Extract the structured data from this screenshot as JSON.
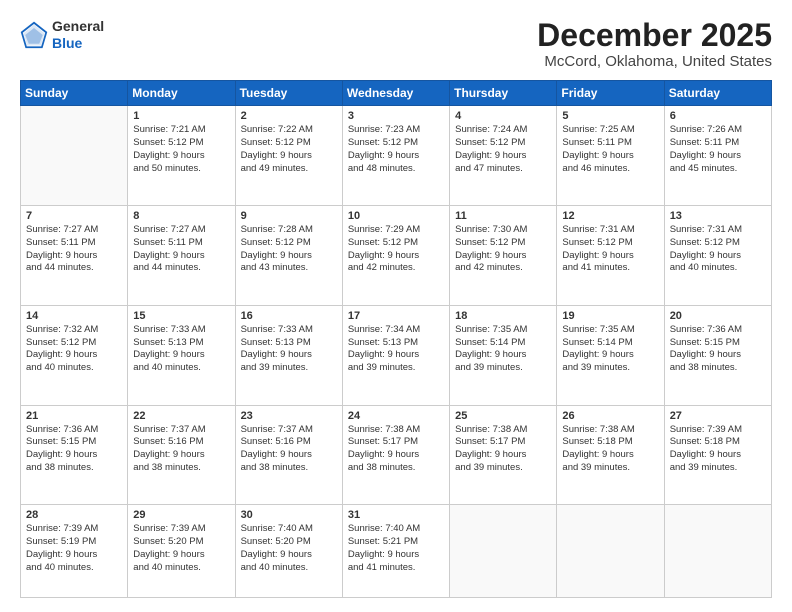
{
  "header": {
    "logo_general": "General",
    "logo_blue": "Blue",
    "month_title": "December 2025",
    "location": "McCord, Oklahoma, United States"
  },
  "weekdays": [
    "Sunday",
    "Monday",
    "Tuesday",
    "Wednesday",
    "Thursday",
    "Friday",
    "Saturday"
  ],
  "weeks": [
    [
      {
        "day": "",
        "info": ""
      },
      {
        "day": "1",
        "info": "Sunrise: 7:21 AM\nSunset: 5:12 PM\nDaylight: 9 hours\nand 50 minutes."
      },
      {
        "day": "2",
        "info": "Sunrise: 7:22 AM\nSunset: 5:12 PM\nDaylight: 9 hours\nand 49 minutes."
      },
      {
        "day": "3",
        "info": "Sunrise: 7:23 AM\nSunset: 5:12 PM\nDaylight: 9 hours\nand 48 minutes."
      },
      {
        "day": "4",
        "info": "Sunrise: 7:24 AM\nSunset: 5:12 PM\nDaylight: 9 hours\nand 47 minutes."
      },
      {
        "day": "5",
        "info": "Sunrise: 7:25 AM\nSunset: 5:11 PM\nDaylight: 9 hours\nand 46 minutes."
      },
      {
        "day": "6",
        "info": "Sunrise: 7:26 AM\nSunset: 5:11 PM\nDaylight: 9 hours\nand 45 minutes."
      }
    ],
    [
      {
        "day": "7",
        "info": "Sunrise: 7:27 AM\nSunset: 5:11 PM\nDaylight: 9 hours\nand 44 minutes."
      },
      {
        "day": "8",
        "info": "Sunrise: 7:27 AM\nSunset: 5:11 PM\nDaylight: 9 hours\nand 44 minutes."
      },
      {
        "day": "9",
        "info": "Sunrise: 7:28 AM\nSunset: 5:12 PM\nDaylight: 9 hours\nand 43 minutes."
      },
      {
        "day": "10",
        "info": "Sunrise: 7:29 AM\nSunset: 5:12 PM\nDaylight: 9 hours\nand 42 minutes."
      },
      {
        "day": "11",
        "info": "Sunrise: 7:30 AM\nSunset: 5:12 PM\nDaylight: 9 hours\nand 42 minutes."
      },
      {
        "day": "12",
        "info": "Sunrise: 7:31 AM\nSunset: 5:12 PM\nDaylight: 9 hours\nand 41 minutes."
      },
      {
        "day": "13",
        "info": "Sunrise: 7:31 AM\nSunset: 5:12 PM\nDaylight: 9 hours\nand 40 minutes."
      }
    ],
    [
      {
        "day": "14",
        "info": "Sunrise: 7:32 AM\nSunset: 5:12 PM\nDaylight: 9 hours\nand 40 minutes."
      },
      {
        "day": "15",
        "info": "Sunrise: 7:33 AM\nSunset: 5:13 PM\nDaylight: 9 hours\nand 40 minutes."
      },
      {
        "day": "16",
        "info": "Sunrise: 7:33 AM\nSunset: 5:13 PM\nDaylight: 9 hours\nand 39 minutes."
      },
      {
        "day": "17",
        "info": "Sunrise: 7:34 AM\nSunset: 5:13 PM\nDaylight: 9 hours\nand 39 minutes."
      },
      {
        "day": "18",
        "info": "Sunrise: 7:35 AM\nSunset: 5:14 PM\nDaylight: 9 hours\nand 39 minutes."
      },
      {
        "day": "19",
        "info": "Sunrise: 7:35 AM\nSunset: 5:14 PM\nDaylight: 9 hours\nand 39 minutes."
      },
      {
        "day": "20",
        "info": "Sunrise: 7:36 AM\nSunset: 5:15 PM\nDaylight: 9 hours\nand 38 minutes."
      }
    ],
    [
      {
        "day": "21",
        "info": "Sunrise: 7:36 AM\nSunset: 5:15 PM\nDaylight: 9 hours\nand 38 minutes."
      },
      {
        "day": "22",
        "info": "Sunrise: 7:37 AM\nSunset: 5:16 PM\nDaylight: 9 hours\nand 38 minutes."
      },
      {
        "day": "23",
        "info": "Sunrise: 7:37 AM\nSunset: 5:16 PM\nDaylight: 9 hours\nand 38 minutes."
      },
      {
        "day": "24",
        "info": "Sunrise: 7:38 AM\nSunset: 5:17 PM\nDaylight: 9 hours\nand 38 minutes."
      },
      {
        "day": "25",
        "info": "Sunrise: 7:38 AM\nSunset: 5:17 PM\nDaylight: 9 hours\nand 39 minutes."
      },
      {
        "day": "26",
        "info": "Sunrise: 7:38 AM\nSunset: 5:18 PM\nDaylight: 9 hours\nand 39 minutes."
      },
      {
        "day": "27",
        "info": "Sunrise: 7:39 AM\nSunset: 5:18 PM\nDaylight: 9 hours\nand 39 minutes."
      }
    ],
    [
      {
        "day": "28",
        "info": "Sunrise: 7:39 AM\nSunset: 5:19 PM\nDaylight: 9 hours\nand 40 minutes."
      },
      {
        "day": "29",
        "info": "Sunrise: 7:39 AM\nSunset: 5:20 PM\nDaylight: 9 hours\nand 40 minutes."
      },
      {
        "day": "30",
        "info": "Sunrise: 7:40 AM\nSunset: 5:20 PM\nDaylight: 9 hours\nand 40 minutes."
      },
      {
        "day": "31",
        "info": "Sunrise: 7:40 AM\nSunset: 5:21 PM\nDaylight: 9 hours\nand 41 minutes."
      },
      {
        "day": "",
        "info": ""
      },
      {
        "day": "",
        "info": ""
      },
      {
        "day": "",
        "info": ""
      }
    ]
  ]
}
